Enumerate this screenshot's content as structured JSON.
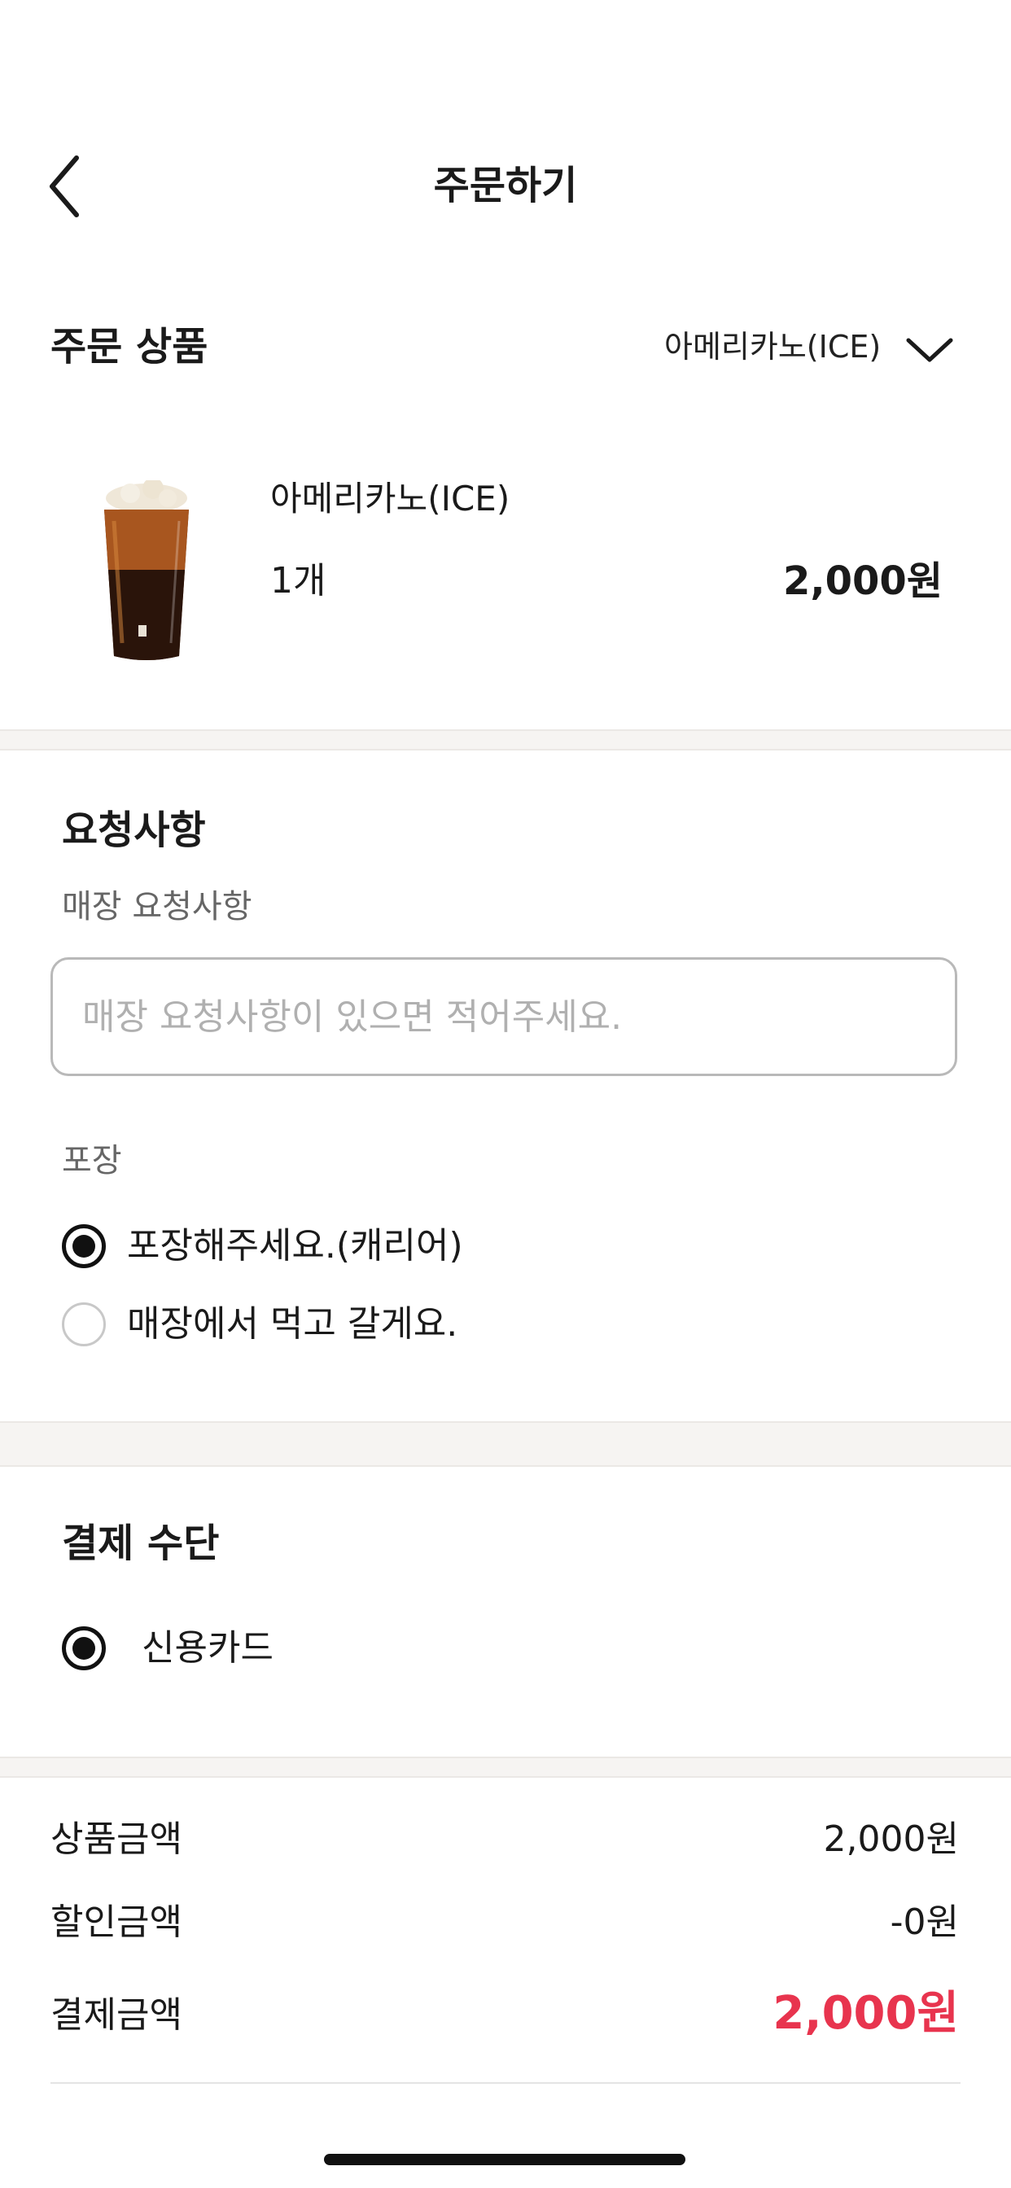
{
  "header": {
    "title": "주문하기",
    "back_icon": "chevron-left-icon"
  },
  "order": {
    "section_title": "주문 상품",
    "selector_label": "아메리카노(ICE)",
    "selector_icon": "chevron-down-icon",
    "product": {
      "name": "아메리카노(ICE)",
      "quantity": "1개",
      "price": "2,000원",
      "image": "iced-americano-image"
    }
  },
  "request": {
    "section_title": "요청사항",
    "store_label": "매장 요청사항",
    "store_placeholder": "매장 요청사항이 있으면 적어주세요.",
    "store_value": "",
    "packaging_label": "포장",
    "packaging_options": [
      {
        "label": "포장해주세요.(캐리어)",
        "selected": true
      },
      {
        "label": "매장에서 먹고 갈게요.",
        "selected": false
      }
    ]
  },
  "payment": {
    "section_title": "결제 수단",
    "methods": [
      {
        "label": "신용카드",
        "selected": true
      }
    ]
  },
  "summary": {
    "items": [
      {
        "label": "상품금액",
        "value": "2,000원"
      },
      {
        "label": "할인금액",
        "value": "-0원"
      }
    ],
    "total_label": "결제금액",
    "total_value": "2,000원"
  },
  "colors": {
    "accent": "#e8344e",
    "text": "#1a1a1a",
    "muted": "#666666",
    "placeholder": "#b0b0b0",
    "divider_bg": "#f6f4f2"
  }
}
